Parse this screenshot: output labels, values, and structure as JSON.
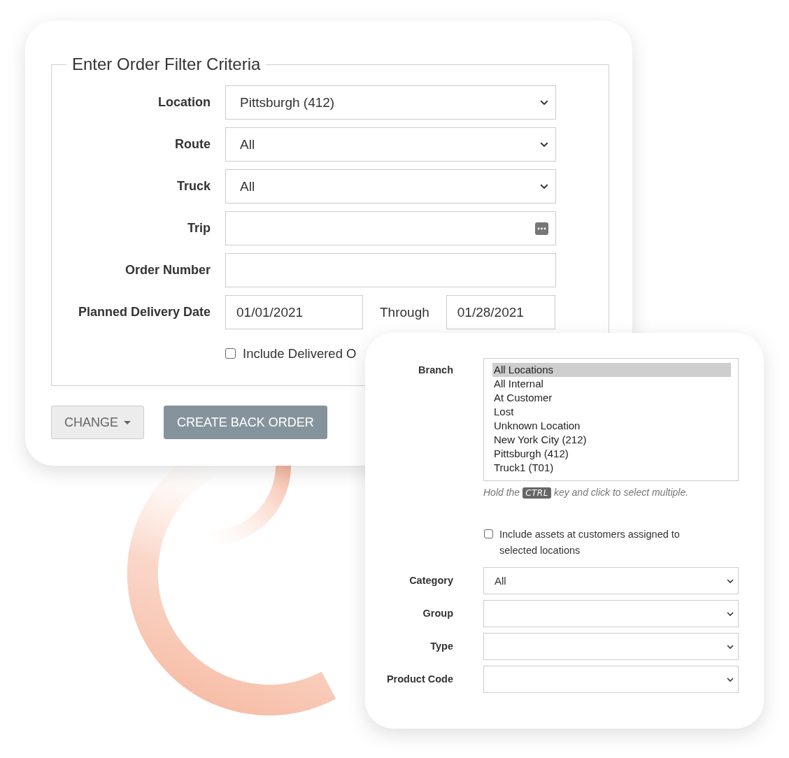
{
  "order_filter": {
    "legend": "Enter Order Filter Criteria",
    "fields": [
      {
        "kind": "select",
        "label": "Location",
        "value": "Pittsburgh (412)"
      },
      {
        "kind": "select",
        "label": "Route",
        "value": "All"
      },
      {
        "kind": "select",
        "label": "Truck",
        "value": "All"
      },
      {
        "kind": "lookup",
        "label": "Trip"
      },
      {
        "kind": "text",
        "label": "Order Number"
      },
      {
        "kind": "date_range",
        "label": "Planned Delivery Date",
        "from": "01/01/2021",
        "separator": "Through",
        "to": "01/28/2021"
      }
    ],
    "include_delivered": {
      "label": "Include Delivered O",
      "checked": false
    },
    "buttons": [
      {
        "kind": "dropdown",
        "label": "CHANGE"
      },
      {
        "kind": "primary",
        "label": "CREATE BACK ORDER"
      }
    ]
  },
  "asset_filter": {
    "branch": {
      "label": "Branch",
      "options": [
        {
          "label": "All Locations",
          "selected": true
        },
        {
          "label": "All Internal",
          "selected": false
        },
        {
          "label": "At Customer",
          "selected": false
        },
        {
          "label": "Lost",
          "selected": false
        },
        {
          "label": "Unknown Location",
          "selected": false
        },
        {
          "label": "New York City (212)",
          "selected": false
        },
        {
          "label": "Pittsburgh (412)",
          "selected": false
        },
        {
          "label": "Truck1 (T01)",
          "selected": false
        }
      ]
    },
    "hint": {
      "before": "Hold the",
      "key": "CTRL",
      "after": "key and click to select multiple."
    },
    "include_assets": {
      "label": "Include assets at customers assigned to selected locations",
      "checked": false
    },
    "selects": [
      {
        "label": "Category",
        "value": "All"
      },
      {
        "label": "Group"
      },
      {
        "label": "Type"
      },
      {
        "label": "Product Code"
      }
    ]
  }
}
